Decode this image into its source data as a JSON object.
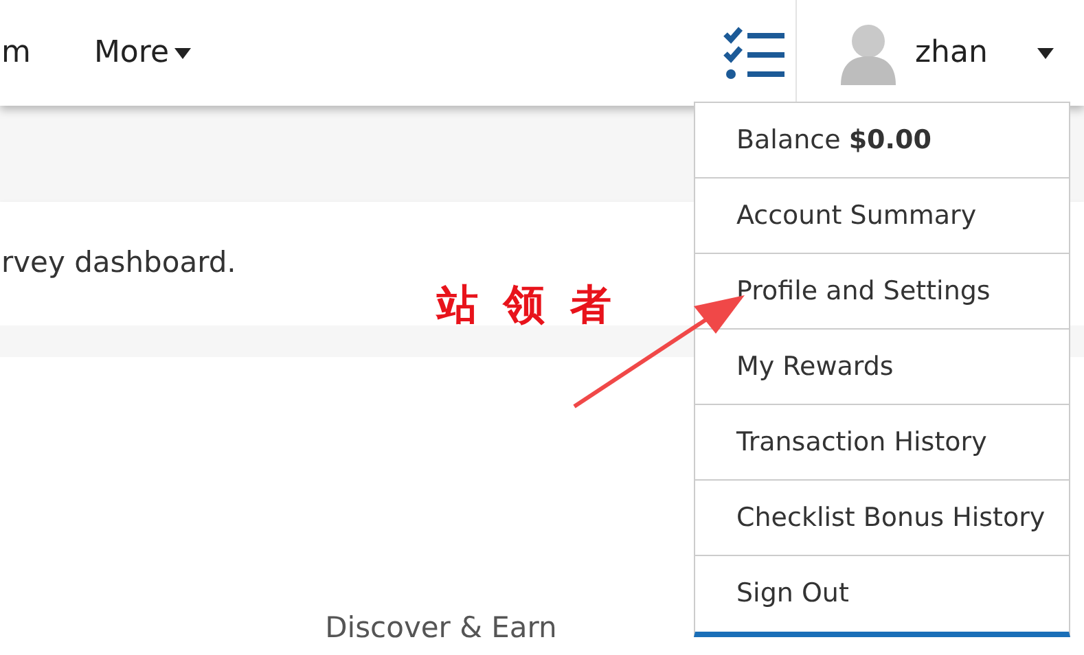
{
  "navbar": {
    "links": [
      {
        "label": "m",
        "kind": "link"
      },
      {
        "label": "More",
        "kind": "dropdown"
      }
    ],
    "user": {
      "name": "zhan"
    }
  },
  "notice": {
    "text": "rvey dashboard."
  },
  "section": {
    "heading": "Discover & Earn"
  },
  "user_menu": {
    "items": [
      {
        "label": "Balance **$0.00**"
      },
      {
        "label": "Account Summary"
      },
      {
        "label": "Profile and Settings"
      },
      {
        "label": "My Rewards"
      },
      {
        "label": "Transaction History"
      },
      {
        "label": "Checklist Bonus History"
      },
      {
        "label": "Sign Out"
      }
    ]
  },
  "annotation": {
    "text": "站 领 者"
  }
}
